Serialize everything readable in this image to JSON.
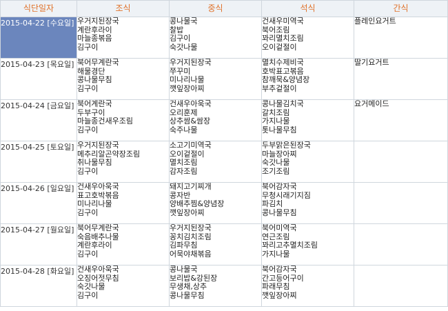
{
  "headers": {
    "date": "식단일자",
    "breakfast": "조식",
    "lunch": "중식",
    "dinner": "석식",
    "snack": "간식"
  },
  "colors": {
    "header_text": "#e0722a",
    "header_bg": "#eef2f6",
    "selected_bg": "#6b86bd",
    "border": "#cfd6dd"
  },
  "rows": [
    {
      "date": "2015-04-22 [수요일]",
      "selected": true,
      "breakfast": [
        "우거지된장국",
        "계란후라이",
        "마늘종볶음",
        "김구이"
      ],
      "lunch": [
        "콩나물국",
        "찰밥",
        "김구이",
        "숙갓나물"
      ],
      "dinner": [
        "건새우미역국",
        "북어조림",
        "꽈리멸치조림",
        "오이겉절이"
      ],
      "snack": [
        "플레인요거트"
      ]
    },
    {
      "date": "2015-04-23 [목요일]",
      "selected": false,
      "breakfast": [
        "북어무계란국",
        "해물경단",
        "콩나물무침",
        "김구이"
      ],
      "lunch": [
        "우거지된장국",
        "쭈꾸미",
        "미나리나물",
        "깻잎장아찌"
      ],
      "dinner": [
        "멸치수제비국",
        "호박표고볶음",
        "참깨묵&양념장",
        "부추겉절이"
      ],
      "snack": [
        "딸기요거트"
      ]
    },
    {
      "date": "2015-04-24 [금요일]",
      "selected": false,
      "breakfast": [
        "북어계란국",
        "두부구이",
        "마늘종건새우조림",
        "김구이"
      ],
      "lunch": [
        "건새우아욱국",
        "오리훈제",
        "상추쌈&쌈장",
        "숙주나물"
      ],
      "dinner": [
        "콩나물김치국",
        "갈치조림",
        "가지나물",
        "톳나물무침"
      ],
      "snack": [
        "요거메이드"
      ]
    },
    {
      "date": "2015-04-25 [토요일]",
      "selected": false,
      "breakfast": [
        "우거지된장국",
        "메추리알곤약장조림",
        "취나물무침",
        "김구이"
      ],
      "lunch": [
        "소고기미역국",
        "오이겉절이",
        "멸치조림",
        "감자조림"
      ],
      "dinner": [
        "두부맑은된장국",
        "마늘장아찌",
        "숙갓나물",
        "조기조림"
      ],
      "snack": []
    },
    {
      "date": "2015-04-26 [일요일]",
      "selected": false,
      "breakfast": [
        "건새우아욱국",
        "표고호박볶음",
        "미나리나물",
        "김구이"
      ],
      "lunch": [
        "돼지고기찌개",
        "콩자반",
        "양배추찜&양념장",
        "깻잎장아찌"
      ],
      "dinner": [
        "북어감자국",
        "무청시래기지짐",
        "파김치",
        "콩나물무침"
      ],
      "snack": []
    },
    {
      "date": "2015-04-27 [월요일]",
      "selected": false,
      "breakfast": [
        "북어무계란국",
        "숙음배추나물",
        "계란후라이",
        "김구이"
      ],
      "lunch": [
        "우거지된장국",
        "꽁치김치조림",
        "김파무침",
        "어묵야채볶음"
      ],
      "dinner": [
        "북어미역국",
        "연근조림",
        "꽈리고추멸치조림",
        "가지나물"
      ],
      "snack": []
    },
    {
      "date": "2015-04-28 [화요일]",
      "selected": false,
      "breakfast": [
        "건새우아욱국",
        "오징어젓무침",
        "숙갓나물",
        "김구이"
      ],
      "lunch": [
        "콩나물국",
        "보리밥&강된장",
        "무생채,상추",
        "콩나물무침"
      ],
      "dinner": [
        "북어감자국",
        "간고등어구이",
        "파래무침",
        "깻잎장아찌"
      ],
      "snack": []
    }
  ]
}
